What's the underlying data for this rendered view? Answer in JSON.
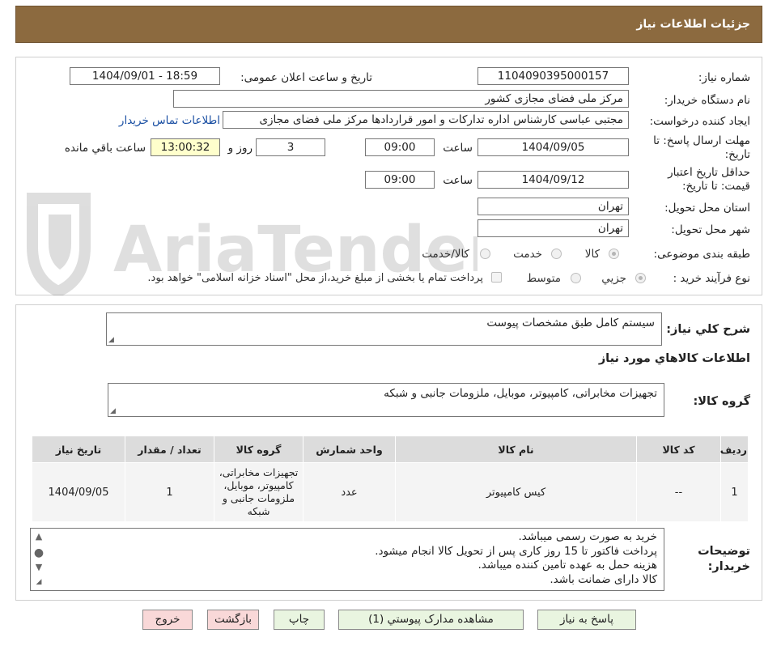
{
  "header": {
    "title": "جزئیات اطلاعات نیاز"
  },
  "form": {
    "need_number": {
      "label": "شماره نیاز:",
      "value": "1104090395000157"
    },
    "announce_datetime": {
      "label": "تاریخ و ساعت اعلان عمومی:",
      "value": "1404/09/01 - 18:59"
    },
    "buyer_org": {
      "label": "نام دستگاه خریدار:",
      "value": "مرکز ملی فضای مجازی کشور"
    },
    "creator": {
      "label": "ایجاد کننده درخواست:",
      "value": "مجتبی عباسی کارشناس اداره تدارکات و امور قراردادها مرکز ملی فضای مجازی",
      "contact_link": "اطلاعات تماس خریدار"
    },
    "deadline": {
      "label": "مهلت ارسال پاسخ: تا تاریخ:",
      "date": "1404/09/05",
      "time_label": "ساعت",
      "time": "09:00",
      "days": "3",
      "days_label": "روز و",
      "remaining": "13:00:32",
      "remaining_label": "ساعت باقي مانده"
    },
    "validity": {
      "label": "حداقل تاریخ اعتبار قیمت: تا تاریخ:",
      "date": "1404/09/12",
      "time_label": "ساعت",
      "time": "09:00"
    },
    "province": {
      "label": "استان محل تحویل:",
      "value": "تهران"
    },
    "city": {
      "label": "شهر محل تحویل:",
      "value": "تهران"
    },
    "category": {
      "label": "طبقه بندی موضوعی:",
      "options": [
        "کالا",
        "خدمت",
        "کالا/خدمت"
      ]
    },
    "process": {
      "label": "نوع فرآیند خرید :",
      "options": [
        "جزیي",
        "متوسط"
      ],
      "note": "پرداخت تمام یا بخشی از مبلغ خرید،از محل \"اسناد خزانه اسلامی\" خواهد بود."
    }
  },
  "summary": {
    "label": "شرح کلي نياز:",
    "value": "سیستم کامل طبق مشخصات پیوست"
  },
  "goods": {
    "title": "اطلاعات کالاهاي مورد نياز",
    "group_label": "گروه کالا:",
    "group_value": "تجهیزات مخابراتی، کامپیوتر، موبایل، ملزومات جانبی و شبکه",
    "table": {
      "headers": [
        "رديف",
        "کد کالا",
        "نام کالا",
        "واحد شمارش",
        "گروه کالا",
        "تعداد / مقدار",
        "تاریخ نیاز"
      ],
      "rows": [
        [
          "1",
          "--",
          "کیس کامپیوتر",
          "عدد",
          "تجهیزات مخابراتی، کامپیوتر، موبایل، ملزومات جانبی و شبکه",
          "1",
          "1404/09/05"
        ]
      ]
    }
  },
  "buyer_notes": {
    "label": "توضیحات خریدار:",
    "lines": [
      "خرید به صورت رسمی میباشد.",
      "پرداخت فاکتور تا 15 روز کاری پس از تحویل کالا انجام میشود.",
      "هزینه حمل به عهده تامین کننده میباشد.",
      "کالا دارای ضمانت باشد."
    ]
  },
  "buttons": {
    "reply": "پاسخ به نياز",
    "attachments": "مشاهده مدارک پيوستي (1)",
    "print": "چاپ",
    "back": "بازگشت",
    "exit": "خروج"
  },
  "watermark": {
    "text": "AriaTender.neT"
  },
  "colors": {
    "header_bg": "#8c6a3f",
    "link": "#1a4fa3",
    "highlight": "#ffffcc",
    "green_button": "#e9f5e0",
    "red_button": "#f9d8d8"
  }
}
